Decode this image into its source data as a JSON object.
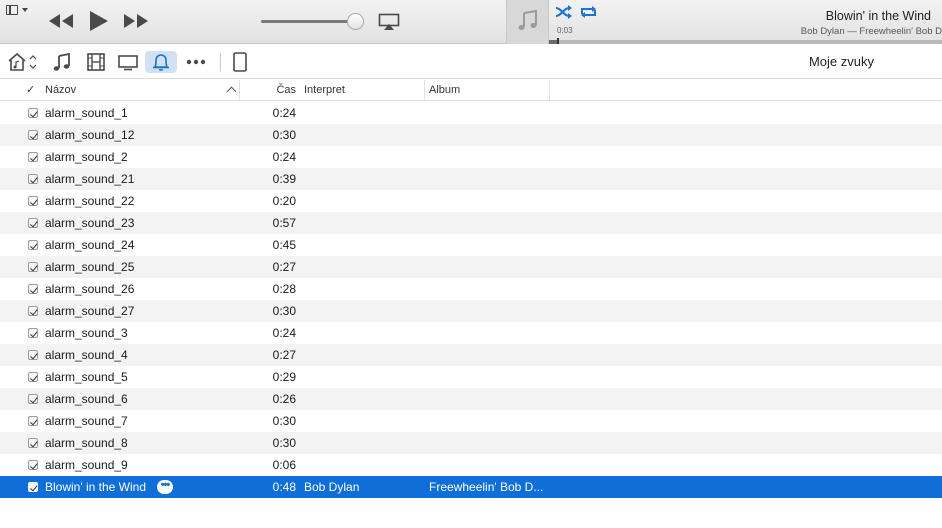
{
  "now_playing": {
    "title": "Blowin' in the Wind",
    "subtitle": "Bob Dylan — Freewheelin' Bob D",
    "elapsed": "0:03",
    "progress": 0.02
  },
  "player": {
    "volume": 0.9
  },
  "toolbar": {
    "view_title": "Moje zvuky",
    "active_tab": "tones"
  },
  "table": {
    "columns": {
      "check": "✓",
      "name": "Názov",
      "time": "Čas",
      "artist": "Interpret",
      "album": "Album"
    },
    "rows": [
      {
        "name": "alarm_sound_1",
        "time": "0:24",
        "artist": "",
        "album": ""
      },
      {
        "name": "alarm_sound_12",
        "time": "0:30",
        "artist": "",
        "album": ""
      },
      {
        "name": "alarm_sound_2",
        "time": "0:24",
        "artist": "",
        "album": ""
      },
      {
        "name": "alarm_sound_21",
        "time": "0:39",
        "artist": "",
        "album": ""
      },
      {
        "name": "alarm_sound_22",
        "time": "0:20",
        "artist": "",
        "album": ""
      },
      {
        "name": "alarm_sound_23",
        "time": "0:57",
        "artist": "",
        "album": ""
      },
      {
        "name": "alarm_sound_24",
        "time": "0:45",
        "artist": "",
        "album": ""
      },
      {
        "name": "alarm_sound_25",
        "time": "0:27",
        "artist": "",
        "album": ""
      },
      {
        "name": "alarm_sound_26",
        "time": "0:28",
        "artist": "",
        "album": ""
      },
      {
        "name": "alarm_sound_27",
        "time": "0:30",
        "artist": "",
        "album": ""
      },
      {
        "name": "alarm_sound_3",
        "time": "0:24",
        "artist": "",
        "album": ""
      },
      {
        "name": "alarm_sound_4",
        "time": "0:27",
        "artist": "",
        "album": ""
      },
      {
        "name": "alarm_sound_5",
        "time": "0:29",
        "artist": "",
        "album": ""
      },
      {
        "name": "alarm_sound_6",
        "time": "0:26",
        "artist": "",
        "album": ""
      },
      {
        "name": "alarm_sound_7",
        "time": "0:30",
        "artist": "",
        "album": ""
      },
      {
        "name": "alarm_sound_8",
        "time": "0:30",
        "artist": "",
        "album": ""
      },
      {
        "name": "alarm_sound_9",
        "time": "0:06",
        "artist": "",
        "album": ""
      },
      {
        "name": "Blowin' in the Wind",
        "time": "0:48",
        "artist": "Bob Dylan",
        "album": "Freewheelin' Bob D...",
        "selected": true,
        "more": "•••"
      }
    ]
  },
  "colors": {
    "selection": "#0f6ed7",
    "accent": "#1a73d0",
    "row_alt": "#f3f3f3"
  },
  "icons": {
    "menu": "window-menu-icon",
    "prev": "rewind-icon",
    "play": "play-icon",
    "next": "fast-forward-icon",
    "airplay": "airplay-icon",
    "artwork": "music-note-icon",
    "shuffle": "shuffle-icon",
    "repeat": "repeat-icon",
    "home": "library-home-icon",
    "music": "music-note-icon",
    "movies": "film-icon",
    "tv": "tv-icon",
    "tones": "bell-icon",
    "more": "ellipsis-icon",
    "device": "ipad-icon"
  }
}
